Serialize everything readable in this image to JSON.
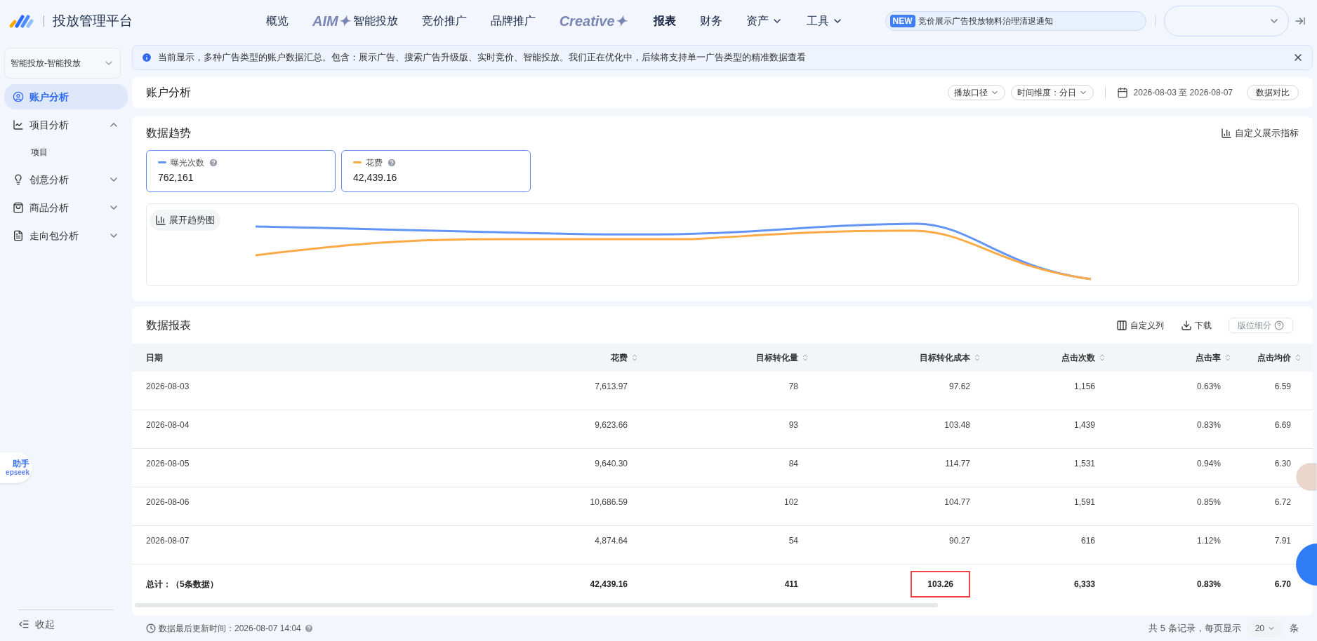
{
  "app": {
    "title": "投放管理平台"
  },
  "nav": [
    {
      "kind": "text",
      "label": "概览",
      "selected": false,
      "dropdown": false
    },
    {
      "kind": "brand",
      "label": "AIM✦",
      "suffix": "智能投放",
      "selected": false,
      "dropdown": false
    },
    {
      "kind": "text",
      "label": "竞价推广",
      "selected": false,
      "dropdown": false
    },
    {
      "kind": "text",
      "label": "品牌推广",
      "selected": false,
      "dropdown": false
    },
    {
      "kind": "brand",
      "label": "Creative✦",
      "selected": false,
      "dropdown": false
    },
    {
      "kind": "text",
      "label": "报表",
      "selected": true,
      "dropdown": false
    },
    {
      "kind": "text",
      "label": "财务",
      "selected": false,
      "dropdown": false
    },
    {
      "kind": "text",
      "label": "资产",
      "selected": false,
      "dropdown": true
    },
    {
      "kind": "text",
      "label": "工具",
      "selected": false,
      "dropdown": true
    }
  ],
  "notice": {
    "badge": "NEW",
    "text": "竞价展示广告投放物料治理清退通知"
  },
  "sidebar": {
    "select": "智能投放-智能投放",
    "items": [
      {
        "label": "账户分析",
        "selected": true,
        "expanded": false
      },
      {
        "label": "项目分析",
        "selected": false,
        "expanded": true,
        "children": [
          {
            "label": "项目",
            "selected": false
          }
        ]
      },
      {
        "label": "创意分析",
        "selected": false,
        "expanded": false
      },
      {
        "label": "商品分析",
        "selected": false,
        "expanded": false
      },
      {
        "label": "走向包分析",
        "selected": false,
        "expanded": false
      }
    ],
    "collapse": "收起"
  },
  "assistant": {
    "label": "助手",
    "sub": "epseek"
  },
  "banner": "当前显示，多种广告类型的账户数据汇总。包含：展示广告、搜索广告升级版、实时竞价、智能投放。我们正在优化中，后续将支持单一广告类型的精准数据查看",
  "header": {
    "title": "账户分析",
    "filters": [
      "播放口径",
      "时间维度：分日"
    ],
    "date_range": "2026-08-03 至 2026-08-07",
    "compare": "数据对比"
  },
  "trend": {
    "title": "数据趋势",
    "customize": "自定义展示指标",
    "expand": "展开趋势图",
    "metrics": [
      {
        "name": "曝光次数",
        "value": "762,161",
        "color": "#6395f9"
      },
      {
        "name": "花费",
        "value": "42,439.16",
        "color": "#fbaa45"
      }
    ]
  },
  "report": {
    "title": "数据报表",
    "actions": [
      "自定义列",
      "下载"
    ],
    "disabled_action": "版位细分",
    "columns": [
      "日期",
      "花费",
      "目标转化量",
      "目标转化成本",
      "点击次数",
      "点击率",
      "点击均价"
    ],
    "rows": [
      [
        "2026-08-03",
        "7,613.97",
        "78",
        "97.62",
        "1,156",
        "0.63%",
        "6.59"
      ],
      [
        "2026-08-04",
        "9,623.66",
        "93",
        "103.48",
        "1,439",
        "0.83%",
        "6.69"
      ],
      [
        "2026-08-05",
        "9,640.30",
        "84",
        "114.77",
        "1,531",
        "0.94%",
        "6.30"
      ],
      [
        "2026-08-06",
        "10,686.59",
        "102",
        "104.77",
        "1,591",
        "0.85%",
        "6.72"
      ],
      [
        "2026-08-07",
        "4,874.64",
        "54",
        "90.27",
        "616",
        "1.12%",
        "7.91"
      ]
    ],
    "total": [
      {
        "text": "总计：（5条数据）",
        "highlighted": false
      },
      {
        "text": "42,439.16",
        "highlighted": false
      },
      {
        "text": "411",
        "highlighted": false
      },
      {
        "text": "103.26",
        "highlighted": true
      },
      {
        "text": "6,333",
        "highlighted": false
      },
      {
        "text": "0.83%",
        "highlighted": false
      },
      {
        "text": "6.70",
        "highlighted": false
      }
    ],
    "updated": "数据最后更新时间：2026-08-07 14:04",
    "pagination": {
      "summary": "共 5 条记录，每页显示",
      "page_size": "20",
      "unit": "条"
    }
  }
}
